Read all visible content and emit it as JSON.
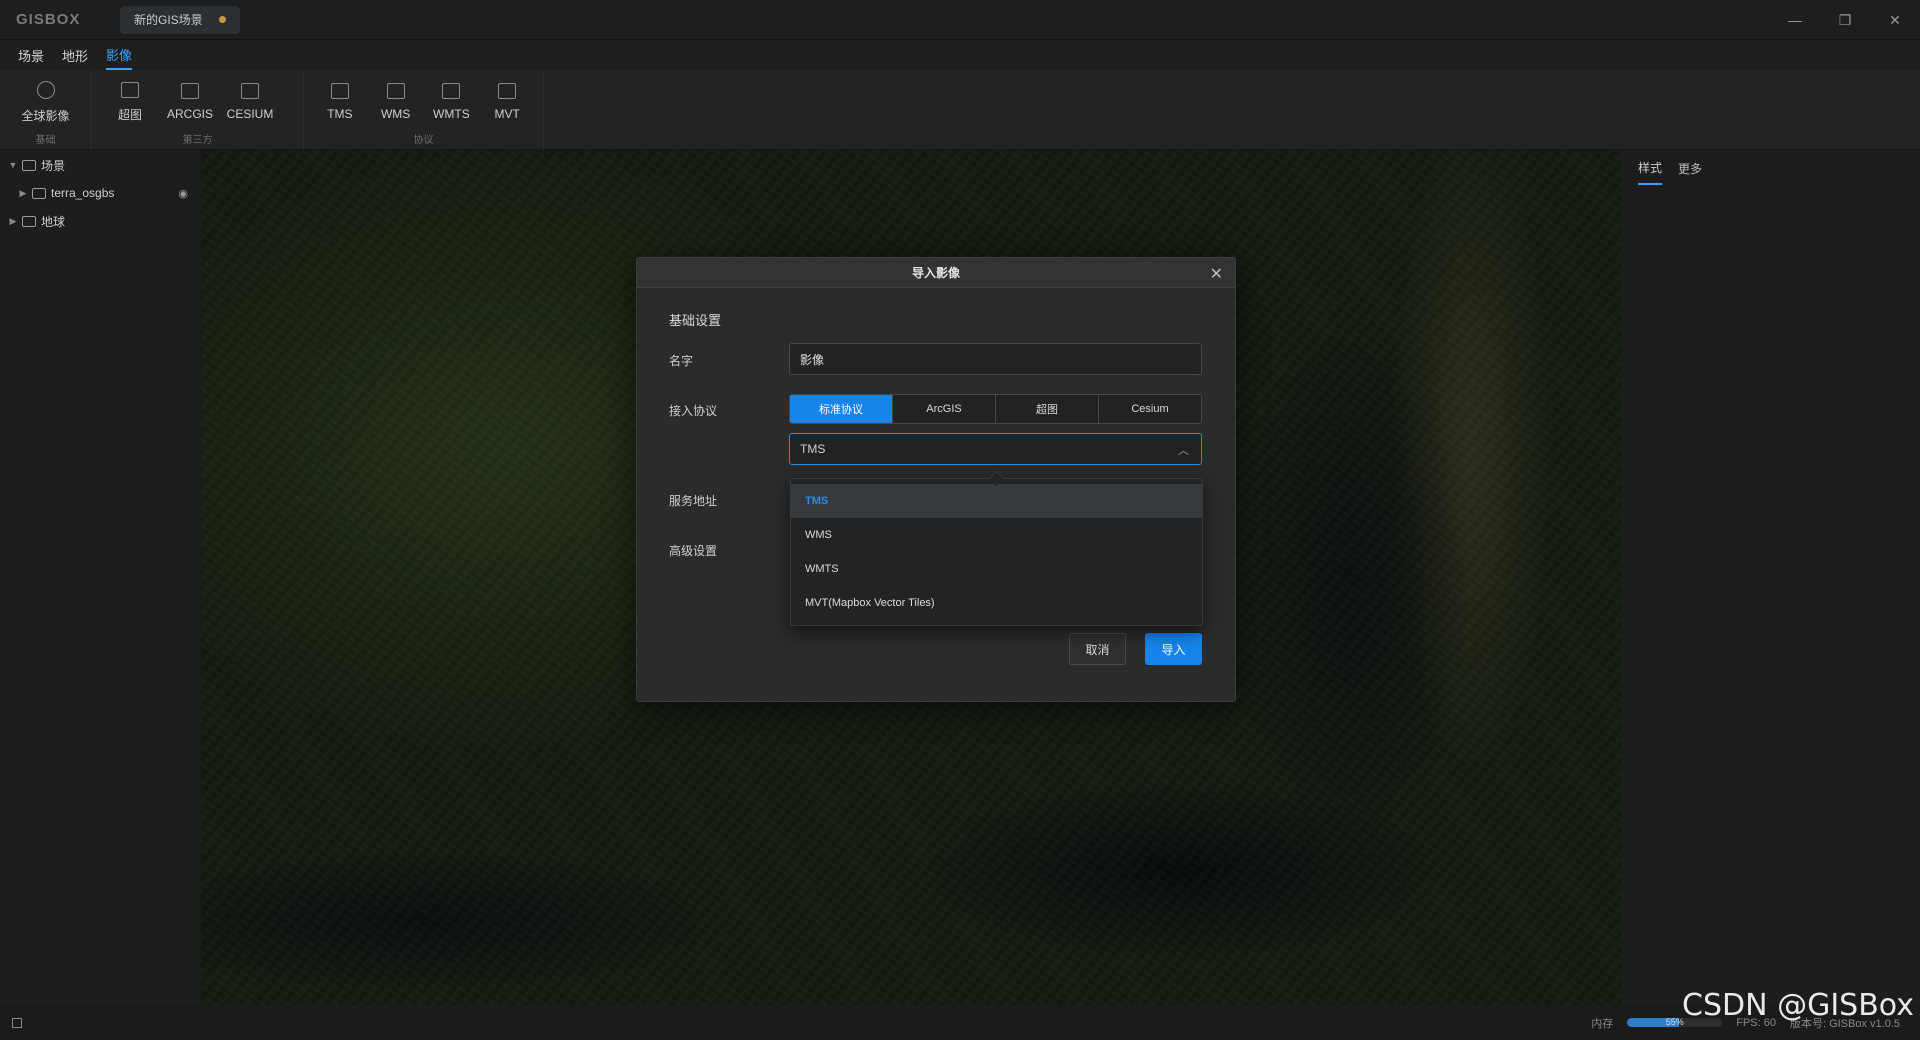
{
  "app": {
    "logo": "GISBOX",
    "scene_tab": "新的GIS场景"
  },
  "window_controls": {
    "minimize": "—",
    "restore": "❐",
    "close": "✕"
  },
  "menu": [
    "场景",
    "地形",
    "影像"
  ],
  "ribbon": {
    "groups": [
      {
        "label": "基础",
        "buttons": [
          "全球影像"
        ]
      },
      {
        "label": "第三方",
        "buttons": [
          "超图",
          "ARCGIS",
          "CESIUM"
        ]
      },
      {
        "label": "协议",
        "buttons": [
          "TMS",
          "WMS",
          "WMTS",
          "MVT"
        ]
      }
    ]
  },
  "tree": {
    "items": [
      {
        "label": "场景",
        "arrow": "▼"
      },
      {
        "label": "terra_osgbs",
        "arrow": "▶"
      },
      {
        "label": "地球",
        "arrow": "▶"
      }
    ]
  },
  "right_panel": {
    "tabs": [
      "样式",
      "更多"
    ]
  },
  "modal": {
    "title": "导入影像",
    "close": "✕",
    "section": "基础设置",
    "name_label": "名字",
    "name_value": "影像",
    "protocol_label": "接入协议",
    "protocol_tabs": [
      "标准协议",
      "ArcGIS",
      "超图",
      "Cesium"
    ],
    "protocol_selected": "TMS",
    "service_label": "服务地址",
    "advanced_label": "高级设置",
    "cancel": "取消",
    "import": "导入"
  },
  "dropdown": {
    "options": [
      "TMS",
      "WMS",
      "WMTS",
      "MVT(Mapbox Vector Tiles)"
    ],
    "selected_index": 0
  },
  "status": {
    "memory_label": "内存",
    "memory_percent": "55%",
    "fps": "FPS: 60",
    "version": "版本号: GISBox v1.0.5"
  },
  "watermark": "CSDN @GISBox",
  "colors": {
    "accent": "#1784ec"
  }
}
